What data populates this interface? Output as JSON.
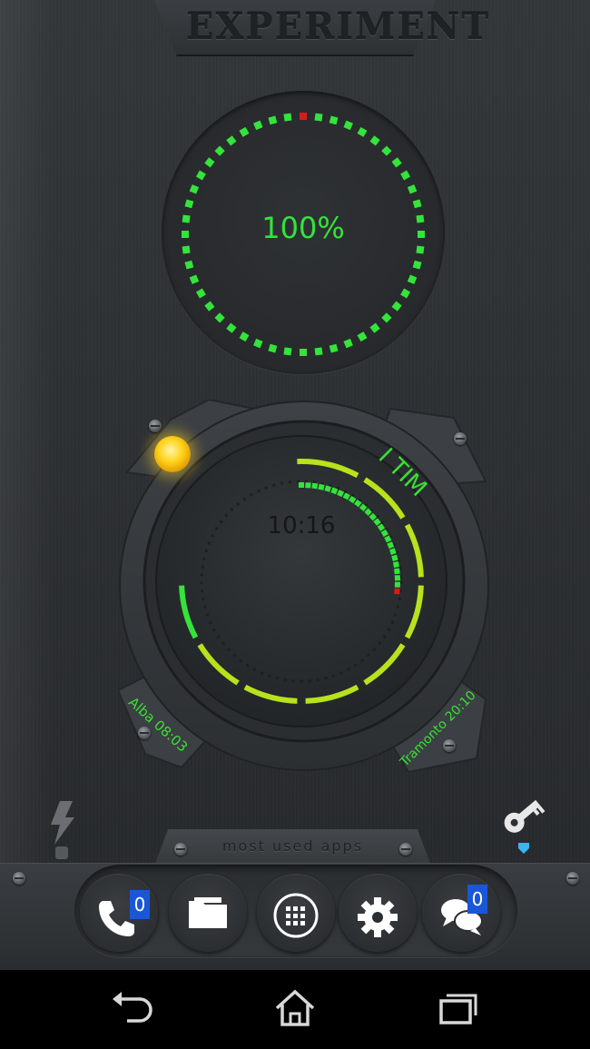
{
  "header": {
    "title": "EXPERIMENT"
  },
  "battery": {
    "percent_label": "100%",
    "level": 1.0,
    "color": "#33e43a",
    "marker_color": "#d81c1c"
  },
  "clock": {
    "time": "10:16",
    "operator": "I TIM",
    "sunrise": "Alba 08:03",
    "sunset": "Tramonto 20:10",
    "hour_arc_color": "#b8e21c",
    "minute_arc_color": "#33e43a",
    "weather_icon": "sun-icon"
  },
  "side_icons": {
    "left": "flash-icon",
    "right": "key-icon",
    "right_indicator_color": "#36b8f0"
  },
  "dock": {
    "label": "most used apps",
    "apps": [
      {
        "name": "phone",
        "icon": "phone-icon",
        "badge": "0"
      },
      {
        "name": "files",
        "icon": "folder-icon",
        "badge": ""
      },
      {
        "name": "app drawer",
        "icon": "app-drawer-icon",
        "badge": ""
      },
      {
        "name": "settings",
        "icon": "gear-icon",
        "badge": ""
      },
      {
        "name": "messages",
        "icon": "chat-icon",
        "badge": "0"
      }
    ]
  },
  "navigation": {
    "back": "back-icon",
    "home": "home-icon",
    "recents": "recents-icon"
  }
}
